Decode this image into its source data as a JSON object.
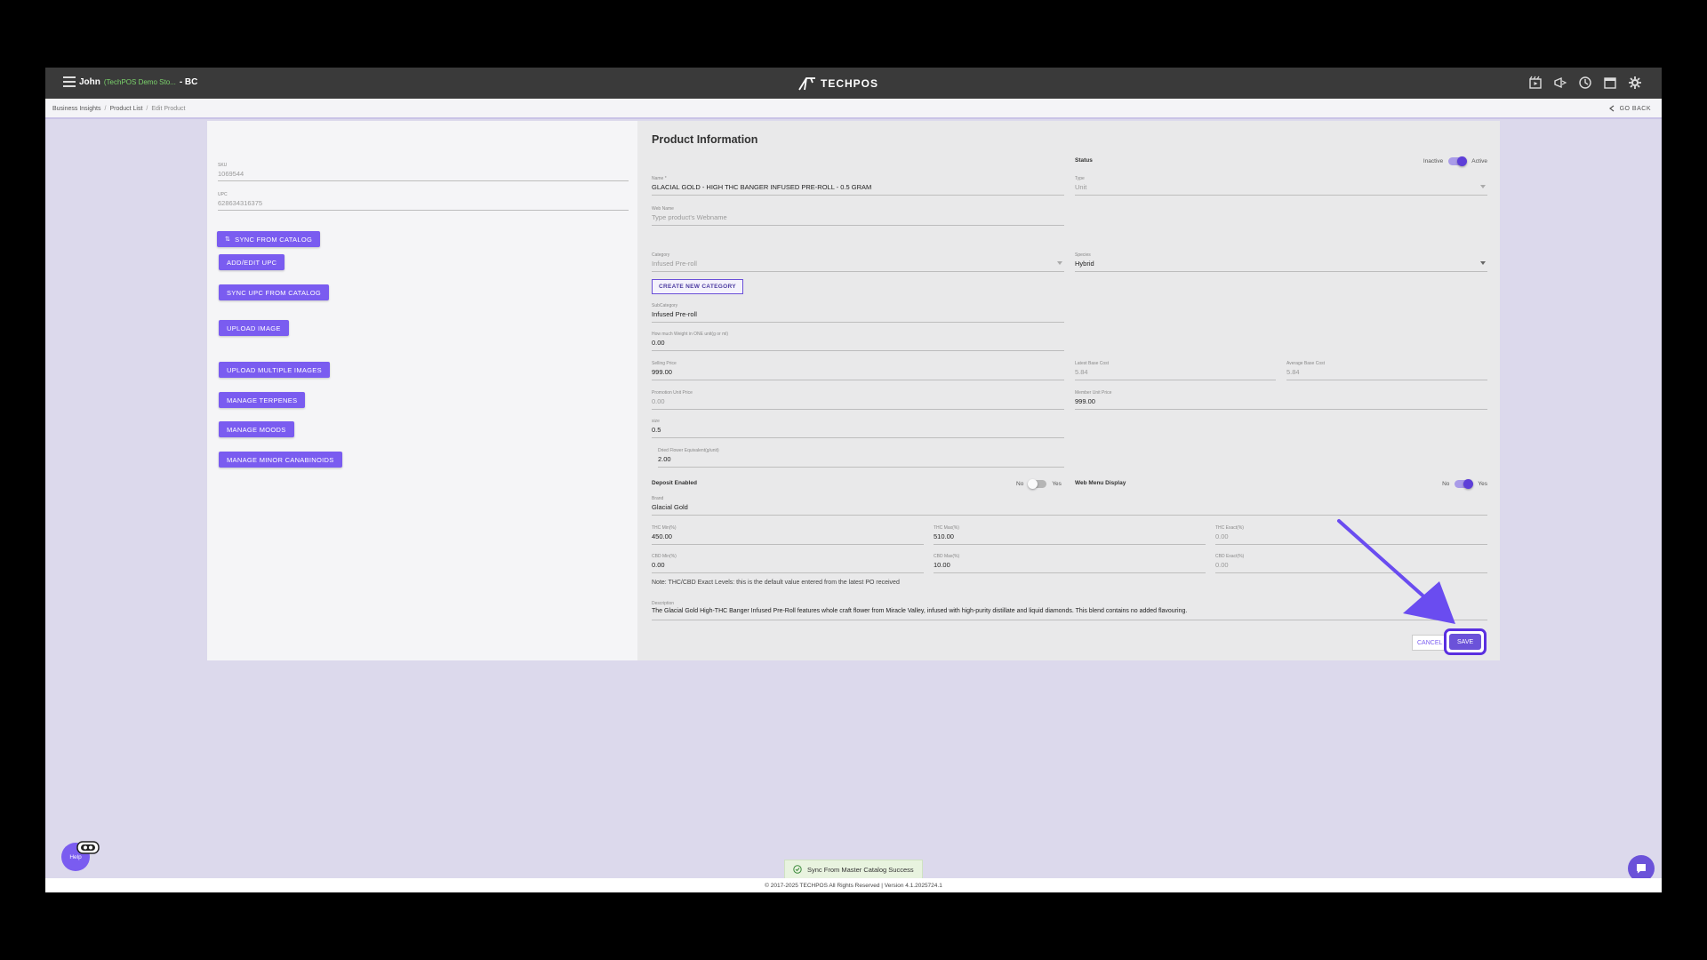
{
  "header": {
    "user": "John",
    "store": "(TechPOS Demo Sto...",
    "region": "- BC",
    "brand": "TECHPOS",
    "icons": [
      "video-icon",
      "megaphone-icon",
      "clock-icon",
      "calendar-icon",
      "gear-icon"
    ]
  },
  "breadcrumb": {
    "items": [
      "Business Insights",
      "Product List"
    ],
    "current": "Edit Product",
    "go_back": "GO BACK"
  },
  "left": {
    "sku": {
      "label": "SKU",
      "value": "1069544"
    },
    "upc": {
      "label": "UPC",
      "value": "628634316375"
    },
    "buttons": {
      "sync_catalog": "SYNC FROM CATALOG",
      "add_upc": "ADD/EDIT UPC",
      "sync_upc": "SYNC UPC FROM CATALOG",
      "upload_image": "UPLOAD IMAGE",
      "upload_multi": "UPLOAD MULTIPLE IMAGES",
      "terpenes": "MANAGE TERPENES",
      "moods": "MANAGE MOODS",
      "minor": "MANAGE MINOR CANABINOIDS"
    }
  },
  "form": {
    "title": "Product Information",
    "status": {
      "label": "Status",
      "off": "Inactive",
      "on": "Active",
      "active": true
    },
    "name": {
      "label": "Name *",
      "value": "GLACIAL GOLD - HIGH THC BANGER INFUSED PRE-ROLL - 0.5 GRAM"
    },
    "type": {
      "label": "Type",
      "value": "Unit"
    },
    "web_name": {
      "label": "Web Name",
      "placeholder": "Type product's Webname"
    },
    "category": {
      "label": "Category",
      "value": "Infused Pre-roll"
    },
    "species": {
      "label": "Species",
      "value": "Hybrid"
    },
    "create_category": "CREATE NEW CATEGORY",
    "subcategory": {
      "label": "SubCategory",
      "value": "Infused Pre-roll"
    },
    "weight": {
      "label": "How much Weight in ONE unit(g or ml)",
      "value": "0.00"
    },
    "selling_price": {
      "label": "Selling Price",
      "value": "999.00"
    },
    "latest_cost": {
      "label": "Latest Base Cost",
      "value": "5.84"
    },
    "avg_cost": {
      "label": "Average Base Cost",
      "value": "5.84"
    },
    "promo_price": {
      "label": "Promotion Unit Price",
      "value": "0.00"
    },
    "member_price": {
      "label": "Member Unit Price",
      "value": "999.00"
    },
    "size": {
      "label": "size",
      "value": "0.5"
    },
    "dried_flower": {
      "label": "Dried Flower Equivalent(g/unit)",
      "value": "2.00"
    },
    "deposit": {
      "label": "Deposit Enabled",
      "no": "No",
      "yes": "Yes",
      "enabled": false
    },
    "web_menu": {
      "label": "Web Menu Display",
      "no": "No",
      "yes": "Yes",
      "enabled": true
    },
    "brand": {
      "label": "Brand",
      "value": "Glacial Gold"
    },
    "thc_min": {
      "label": "THC Min(%)",
      "value": "450.00"
    },
    "thc_max": {
      "label": "THC Max(%)",
      "value": "510.00"
    },
    "thc_exact": {
      "label": "THC Exact(%)",
      "value": "0.00"
    },
    "cbd_min": {
      "label": "CBD Min(%)",
      "value": "0.00"
    },
    "cbd_max": {
      "label": "CBD Max(%)",
      "value": "10.00"
    },
    "cbd_exact": {
      "label": "CBD Exact(%)",
      "value": "0.00"
    },
    "note": "Note: THC/CBD Exact Levels: this is the default value entered from the latest PO received",
    "description": {
      "label": "Description",
      "value": "The Glacial Gold High-THC Banger Infused Pre-Roll features whole craft flower from Miracle Valley, infused with high-purity distillate and liquid diamonds. This blend contains no added flavouring."
    },
    "cancel": "CANCEL",
    "save": "SAVE"
  },
  "toast": "Sync From Master Catalog Success",
  "footer": "© 2017-2025 TECHPOS All Rights Reserved | Version 4.1.2025724.1",
  "help": "Help",
  "colors": {
    "accent": "#7a5cf0",
    "annotation_arrow": "#6a4cf0",
    "topbar": "#3a3a3a"
  }
}
